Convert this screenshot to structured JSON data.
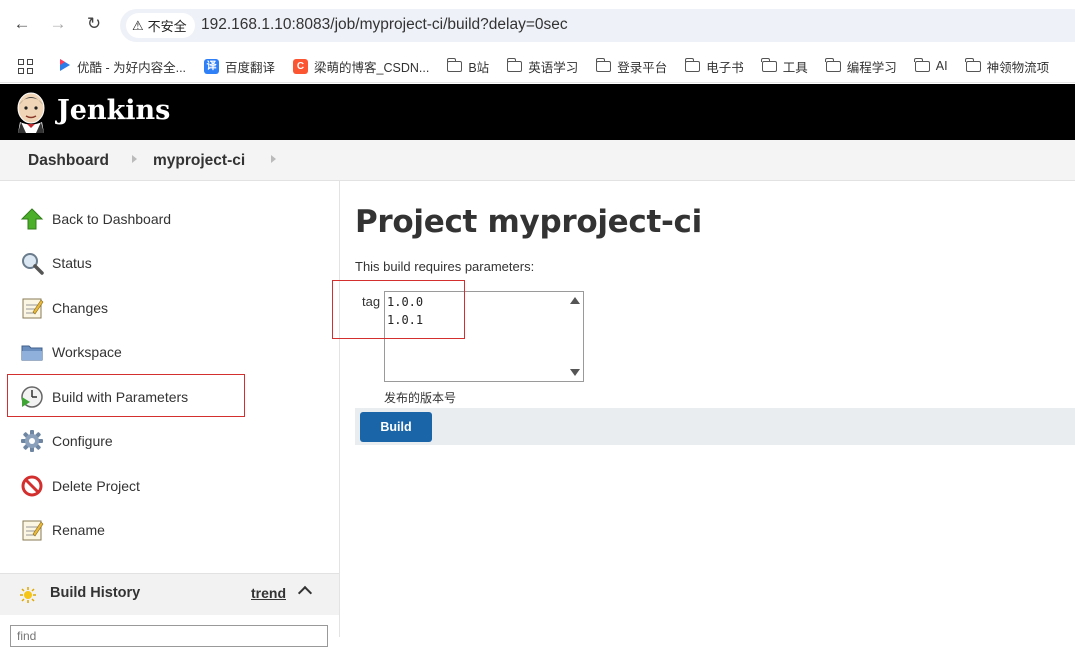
{
  "browser": {
    "security_label": "不安全",
    "url": "192.168.1.10:8083/job/myproject-ci/build?delay=0sec",
    "bookmarks": [
      {
        "label": "优酷 - 为好内容全...",
        "icon": "youku-icon"
      },
      {
        "label": "百度翻译",
        "icon": "baidu-translate-icon"
      },
      {
        "label": "梁萌的博客_CSDN...",
        "icon": "csdn-icon"
      },
      {
        "label": "B站",
        "icon": "folder-icon"
      },
      {
        "label": "英语学习",
        "icon": "folder-icon"
      },
      {
        "label": "登录平台",
        "icon": "folder-icon"
      },
      {
        "label": "电子书",
        "icon": "folder-icon"
      },
      {
        "label": "工具",
        "icon": "folder-icon"
      },
      {
        "label": "编程学习",
        "icon": "folder-icon"
      },
      {
        "label": "AI",
        "icon": "folder-icon"
      },
      {
        "label": "神领物流项",
        "icon": "folder-icon"
      }
    ]
  },
  "header": {
    "title": "Jenkins"
  },
  "breadcrumb": {
    "items": [
      "Dashboard",
      "myproject-ci"
    ]
  },
  "sidebar": {
    "items": [
      {
        "label": "Back to Dashboard",
        "icon": "up-arrow-icon"
      },
      {
        "label": "Status",
        "icon": "magnifier-icon"
      },
      {
        "label": "Changes",
        "icon": "notepad-icon"
      },
      {
        "label": "Workspace",
        "icon": "folder-icon"
      },
      {
        "label": "Build with Parameters",
        "icon": "clock-play-icon"
      },
      {
        "label": "Configure",
        "icon": "gear-icon"
      },
      {
        "label": "Delete Project",
        "icon": "no-entry-icon"
      },
      {
        "label": "Rename",
        "icon": "notepad-icon"
      }
    ],
    "build_history": {
      "title": "Build History",
      "trend": "trend",
      "find_placeholder": "find"
    }
  },
  "main": {
    "title": "Project myproject-ci",
    "requires": "This build requires parameters:",
    "param": {
      "name": "tag",
      "value": "1.0.0\n1.0.1",
      "description": "发布的版本号"
    },
    "build_label": "Build"
  },
  "colors": {
    "header_bg": "#000000",
    "build_button": "#1965a8",
    "highlight": "#d32f2f"
  }
}
